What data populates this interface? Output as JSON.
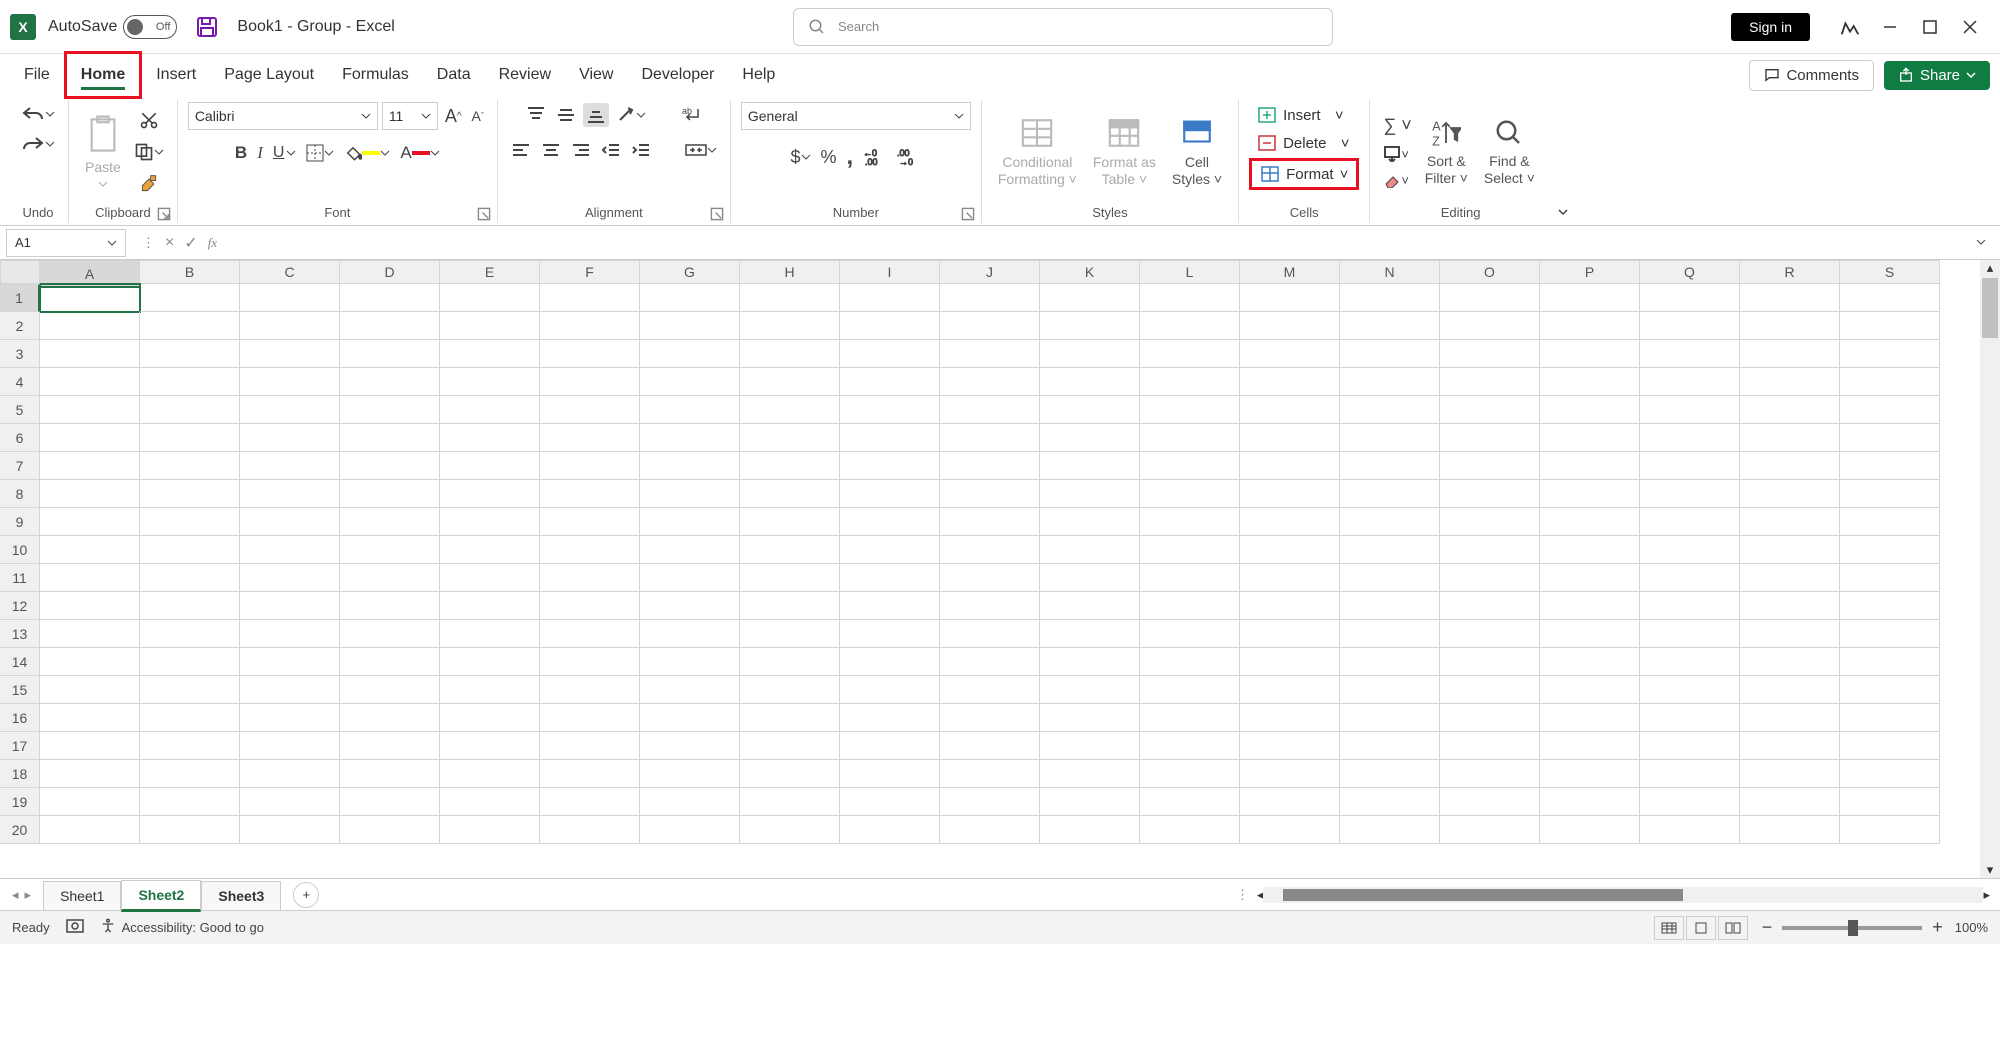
{
  "titlebar": {
    "autosave_label": "AutoSave",
    "autosave_state": "Off",
    "doc_title": "Book1  -  Group  -  Excel",
    "search_placeholder": "Search",
    "signin": "Sign in"
  },
  "tabs": {
    "file": "File",
    "home": "Home",
    "insert": "Insert",
    "page_layout": "Page Layout",
    "formulas": "Formulas",
    "data": "Data",
    "review": "Review",
    "view": "View",
    "developer": "Developer",
    "help": "Help",
    "comments": "Comments",
    "share": "Share"
  },
  "ribbon": {
    "undo_group": "Undo",
    "clipboard_group": "Clipboard",
    "paste": "Paste",
    "font_group": "Font",
    "font_name": "Calibri",
    "font_size": "11",
    "alignment_group": "Alignment",
    "number_group": "Number",
    "number_format": "General",
    "styles_group": "Styles",
    "cond_fmt": "Conditional Formatting",
    "fmt_table": "Format as Table",
    "cell_styles": "Cell Styles",
    "cells_group": "Cells",
    "insert": "Insert",
    "delete": "Delete",
    "format": "Format",
    "editing_group": "Editing",
    "sort_filter": "Sort & Filter",
    "find_select": "Find & Select"
  },
  "namebox": "A1",
  "columns": [
    "A",
    "B",
    "C",
    "D",
    "E",
    "F",
    "G",
    "H",
    "I",
    "J",
    "K",
    "L",
    "M",
    "N",
    "O",
    "P",
    "Q",
    "R",
    "S"
  ],
  "rows": [
    "1",
    "2",
    "3",
    "4",
    "5",
    "6",
    "7",
    "8",
    "9",
    "10",
    "11",
    "12",
    "13",
    "14",
    "15",
    "16",
    "17",
    "18",
    "19",
    "20"
  ],
  "sheets": {
    "s1": "Sheet1",
    "s2": "Sheet2",
    "s3": "Sheet3"
  },
  "status": {
    "ready": "Ready",
    "accessibility": "Accessibility: Good to go",
    "zoom": "100%"
  }
}
